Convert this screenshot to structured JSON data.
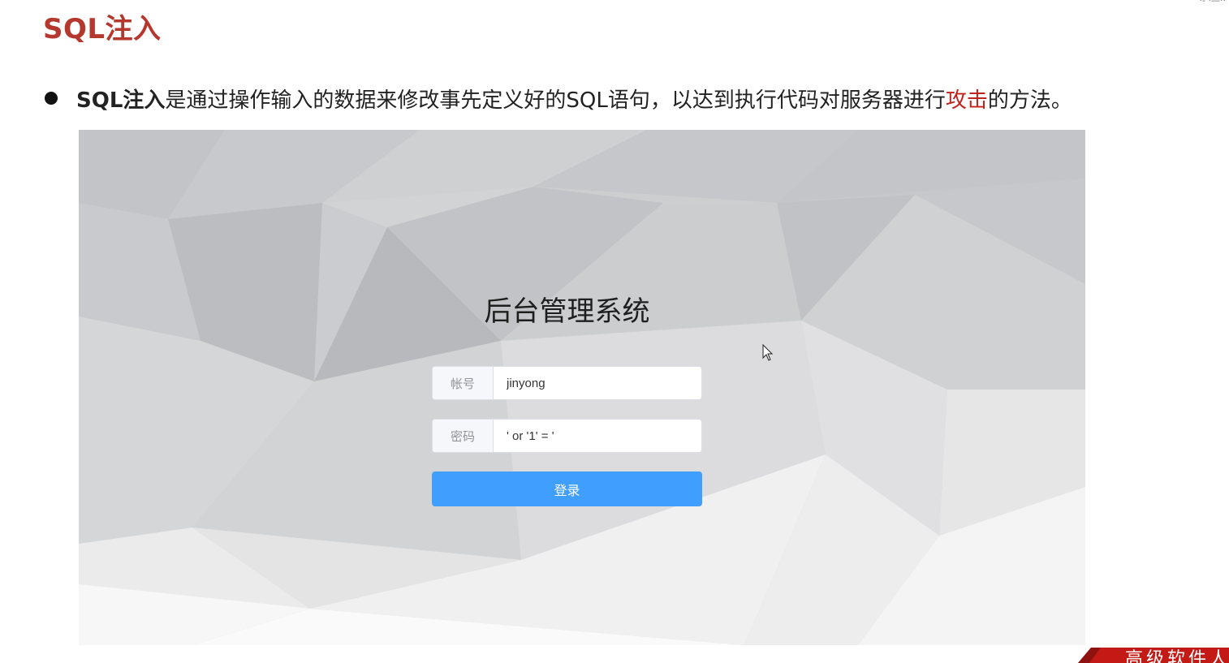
{
  "slide": {
    "title": "SQL注入",
    "bullet": {
      "term": "SQL注入",
      "text_before": "是通过操作输入的数据来修改事先定义好的SQL语句，以达到执行代码对服务器进行",
      "highlight": "攻击",
      "text_after": "的方法。"
    },
    "corner_mark": "·- ·—··",
    "corner_banner": "高级软件人"
  },
  "login": {
    "title": "后台管理系统",
    "username_label": "帐号",
    "username_value": "jinyong",
    "password_label": "密码",
    "password_value": "' or '1' = '",
    "submit_label": "登录"
  },
  "colors": {
    "title_red": "#b5382e",
    "highlight_red": "#c0231c",
    "button_blue": "#409eff",
    "banner_red": "#c41a16"
  },
  "icons": {
    "bullet": "filled-circle",
    "cursor": "mouse-pointer-icon"
  }
}
